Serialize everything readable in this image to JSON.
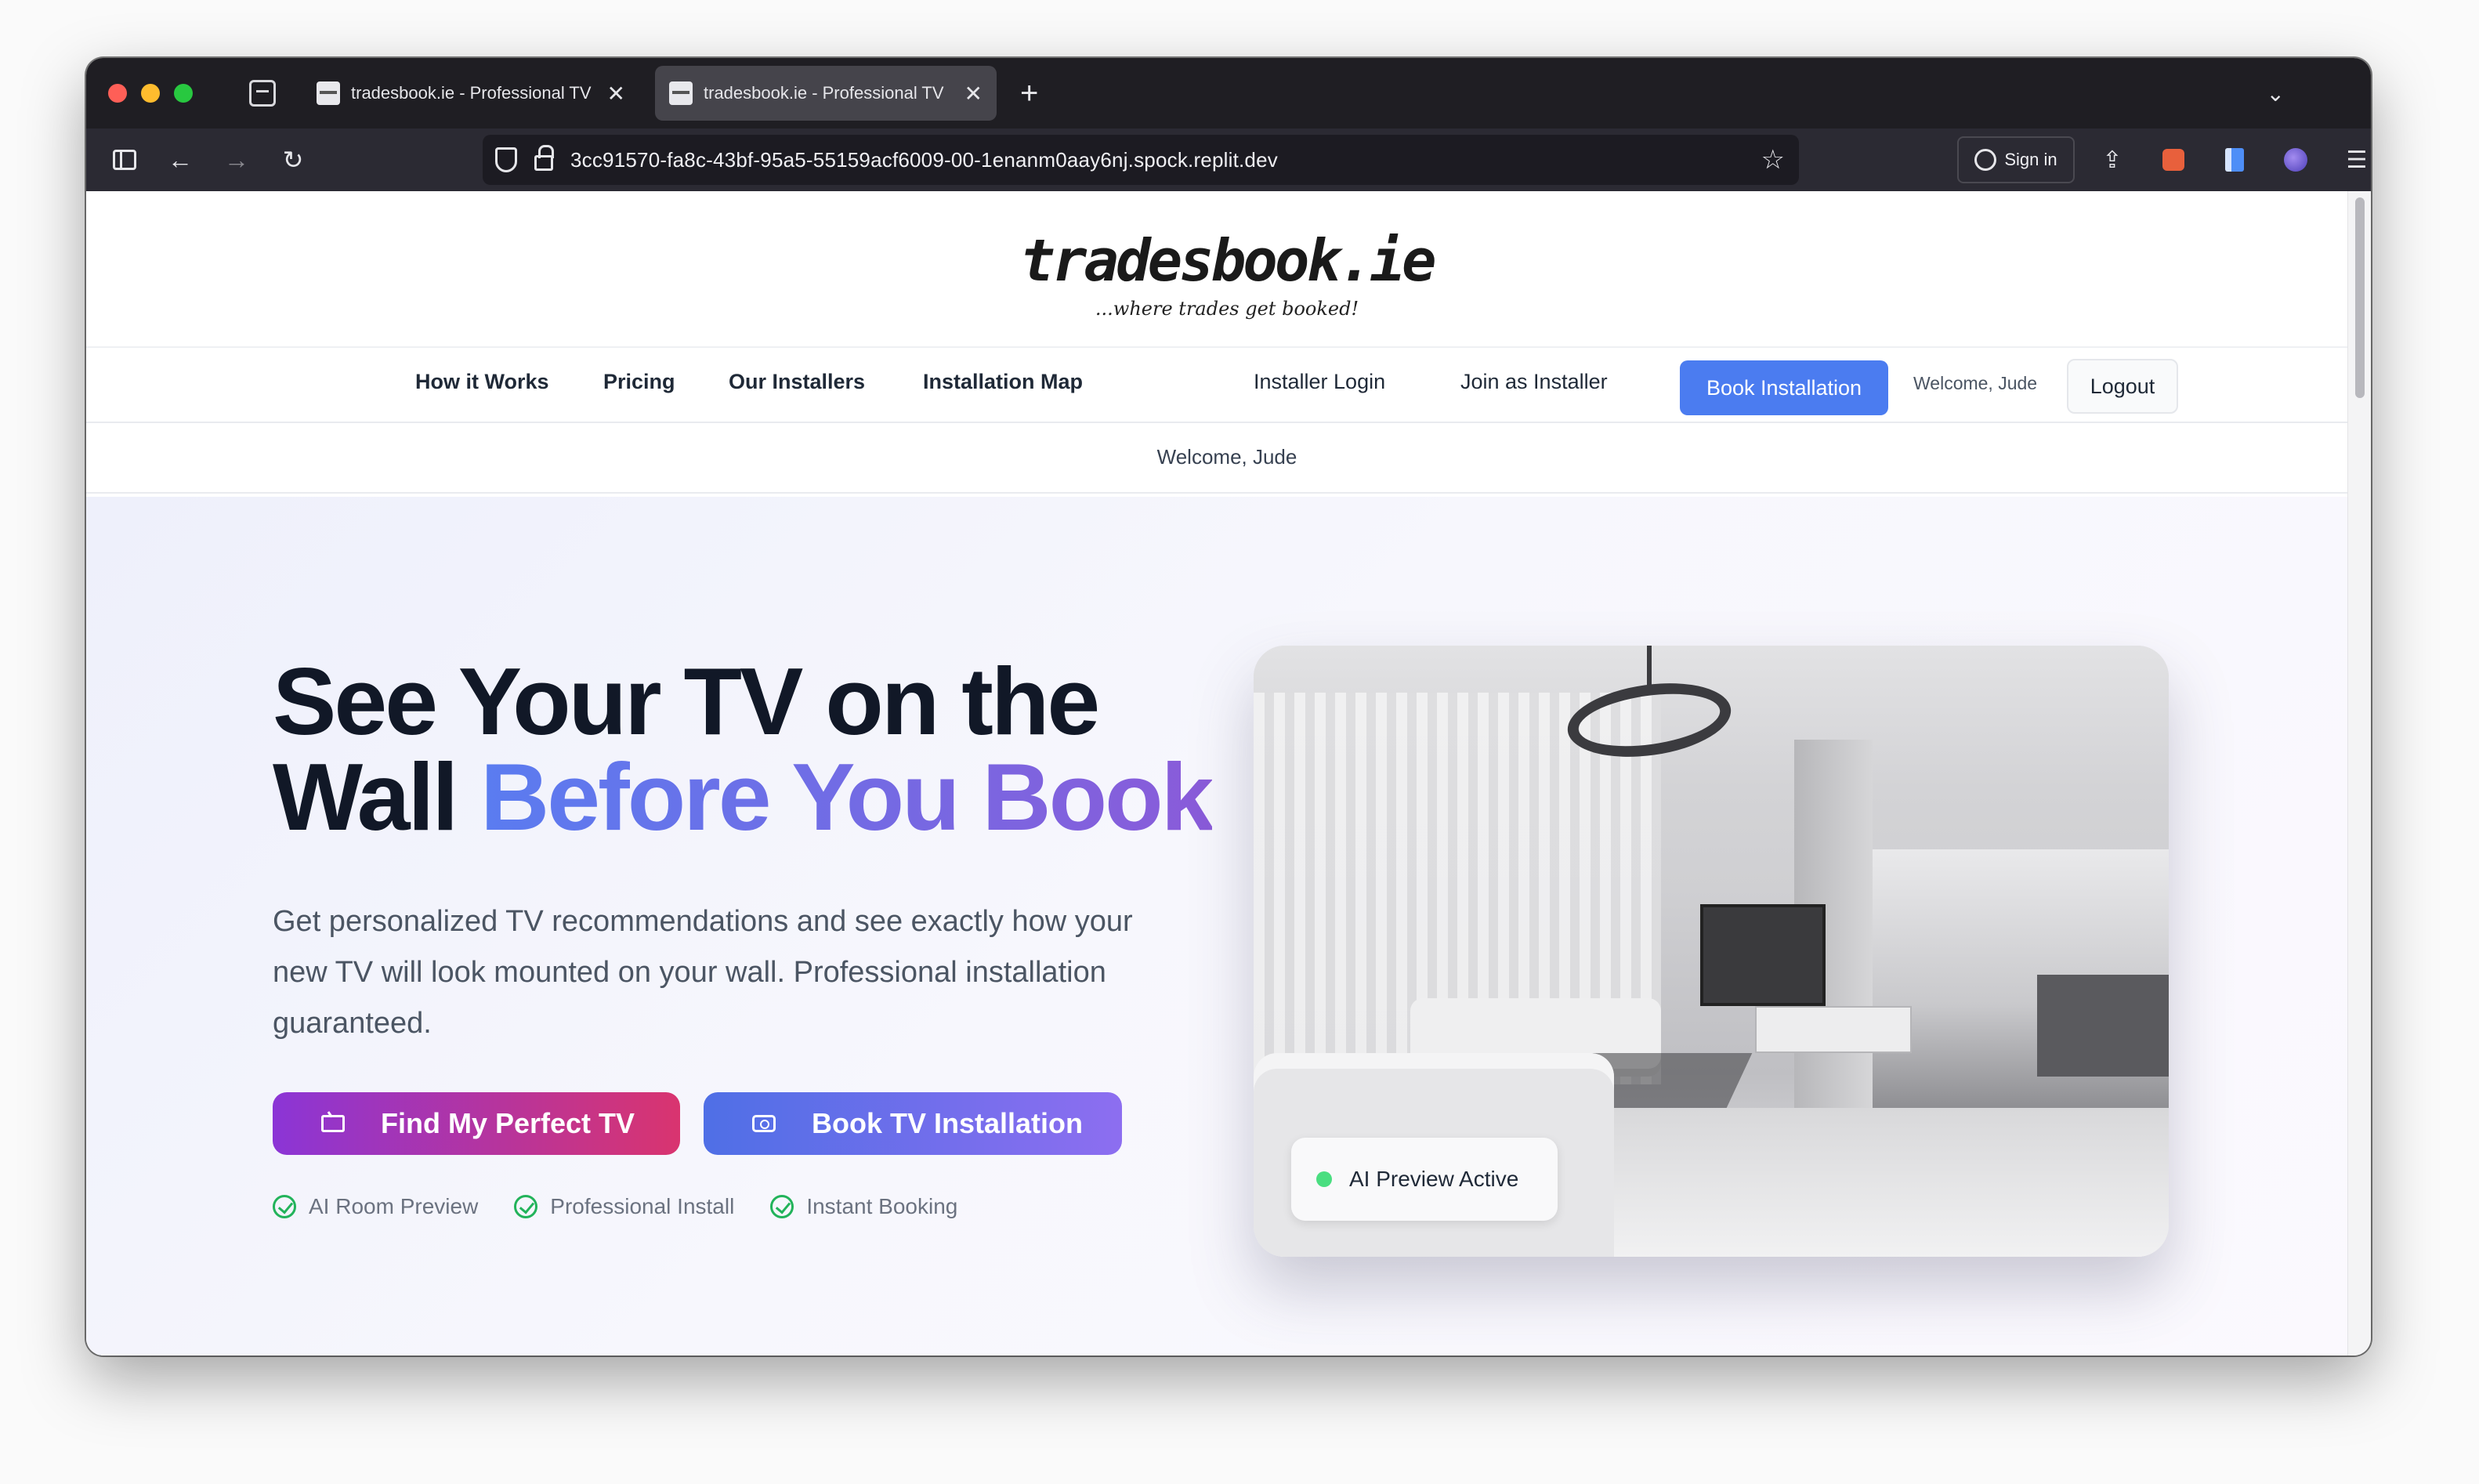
{
  "browser": {
    "tabs": [
      {
        "title": "tradesbook.ie - Professional TV",
        "active": false
      },
      {
        "title": "tradesbook.ie - Professional TV",
        "active": true
      }
    ],
    "url": "3cc91570-fa8c-43bf-95a5-55159acf6009-00-1enanm0aay6nj.spock.replit.dev",
    "signin_label": "Sign in"
  },
  "site": {
    "logo": "tradesbook.ie",
    "tagline": "...where trades get booked!",
    "nav": {
      "how_it_works": "How it Works",
      "pricing": "Pricing",
      "our_installers": "Our Installers",
      "installation_map": "Installation Map",
      "installer_login": "Installer Login",
      "join_as_installer": "Join as Installer",
      "book_installation": "Book Installation",
      "welcome": "Welcome, Jude",
      "logout": "Logout"
    },
    "welcome_bar": "Welcome, Jude"
  },
  "hero": {
    "headline_part1": "See Your TV on the Wall",
    "headline_highlight": "Before You Book",
    "subtext": "Get personalized TV recommendations and see exactly how your new TV will look mounted on your wall. Professional installation guaranteed.",
    "cta_primary": "Find My Perfect TV",
    "cta_secondary": "Book TV Installation",
    "features": [
      "AI Room Preview",
      "Professional Install",
      "Instant Booking"
    ],
    "preview_badge": "AI Preview Active"
  },
  "colors": {
    "accent_blue": "#4b7cf0",
    "cta_purple": "#8b35d6",
    "cta_pink": "#d9346f",
    "check_green": "#22b35a",
    "status_green": "#4ade80"
  }
}
